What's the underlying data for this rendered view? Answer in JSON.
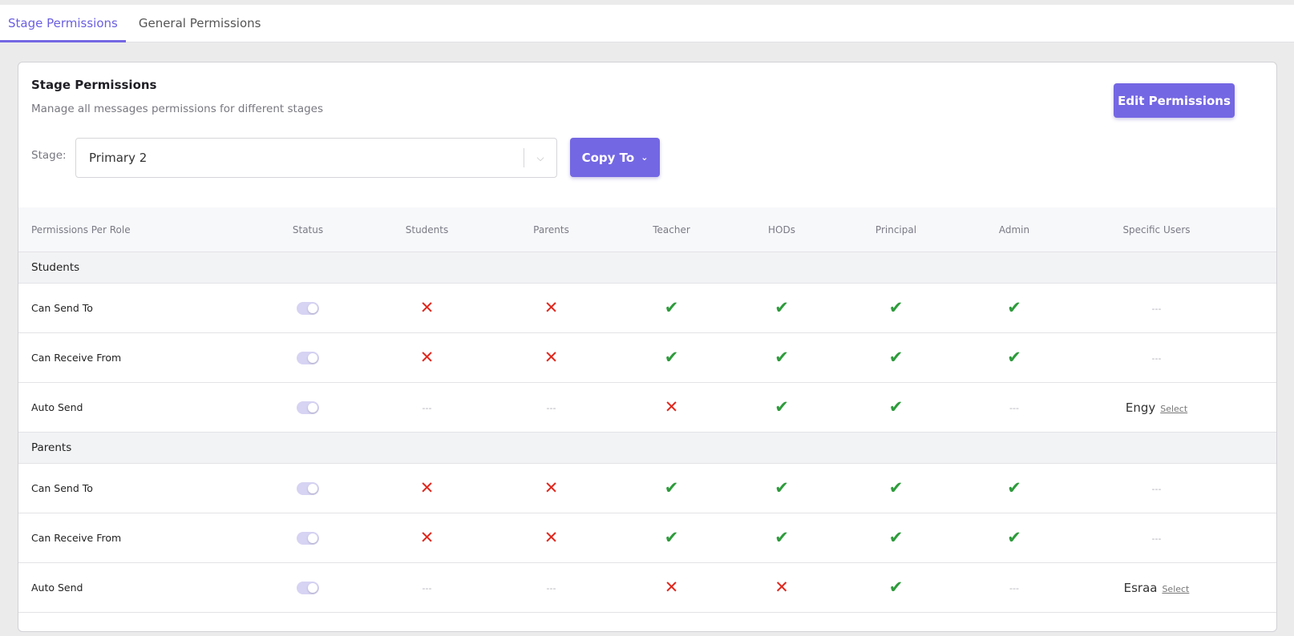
{
  "tabs": [
    {
      "label": "Stage Permissions",
      "active": true
    },
    {
      "label": "General Permissions",
      "active": false
    }
  ],
  "card": {
    "title": "Stage Permissions",
    "subtitle": "Manage all messages permissions for different stages",
    "edit_button": "Edit Permissions",
    "stage_label": "Stage:",
    "stage_value": "Primary 2",
    "copy_button": "Copy To"
  },
  "columns": [
    "Permissions Per Role",
    "Status",
    "Students",
    "Parents",
    "Teacher",
    "HODs",
    "Principal",
    "Admin",
    "Specific Users"
  ],
  "groups": [
    {
      "name": "Students",
      "rows": [
        {
          "label": "Can Send To",
          "status": true,
          "values": [
            "no",
            "no",
            "yes",
            "yes",
            "yes",
            "yes"
          ],
          "specific": "---"
        },
        {
          "label": "Can Receive From",
          "status": true,
          "values": [
            "no",
            "no",
            "yes",
            "yes",
            "yes",
            "yes"
          ],
          "specific": "---"
        },
        {
          "label": "Auto Send",
          "status": true,
          "values": [
            "none",
            "none",
            "no",
            "yes",
            "yes",
            "none"
          ],
          "specific_user": "Engy",
          "select_label": "Select"
        }
      ]
    },
    {
      "name": "Parents",
      "rows": [
        {
          "label": "Can Send To",
          "status": true,
          "values": [
            "no",
            "no",
            "yes",
            "yes",
            "yes",
            "yes"
          ],
          "specific": "---"
        },
        {
          "label": "Can Receive From",
          "status": true,
          "values": [
            "no",
            "no",
            "yes",
            "yes",
            "yes",
            "yes"
          ],
          "specific": "---"
        },
        {
          "label": "Auto Send",
          "status": true,
          "values": [
            "none",
            "none",
            "no",
            "no",
            "yes",
            "none"
          ],
          "specific_user": "Esraa",
          "select_label": "Select"
        }
      ]
    }
  ],
  "symbols": {
    "yes": "✔",
    "no": "✕",
    "none": "---"
  },
  "colors": {
    "accent": "#7467e3",
    "yes": "#2e9b3c",
    "no": "#e0281e",
    "toggle_on": "#d6d3f3"
  }
}
